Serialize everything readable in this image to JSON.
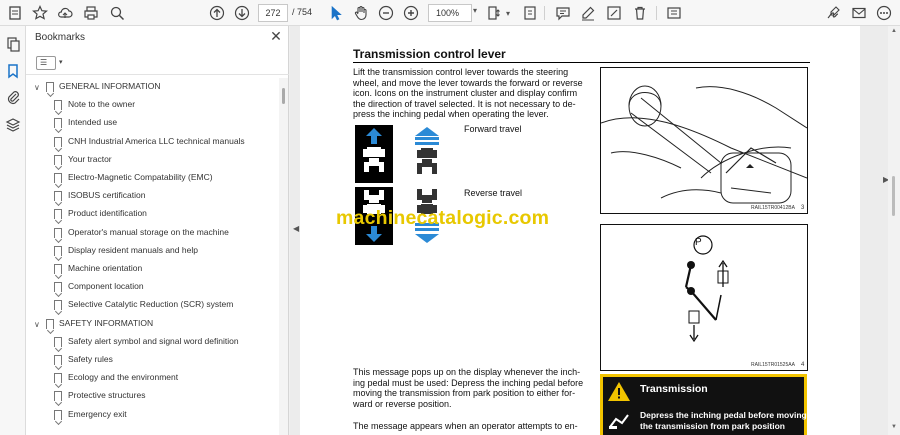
{
  "toolbar": {
    "page_current": "272",
    "page_total": "/ 754",
    "zoom": "100%"
  },
  "bookmarks": {
    "title": "Bookmarks",
    "items": [
      {
        "label": "GENERAL INFORMATION",
        "level": 0,
        "expanded": true
      },
      {
        "label": "Note to the owner",
        "level": 1
      },
      {
        "label": "Intended use",
        "level": 1
      },
      {
        "label": "CNH Industrial America LLC technical manuals",
        "level": 1
      },
      {
        "label": "Your tractor",
        "level": 1
      },
      {
        "label": "Electro-Magnetic Compatability (EMC)",
        "level": 1
      },
      {
        "label": "ISOBUS certification",
        "level": 1
      },
      {
        "label": "Product identification",
        "level": 1
      },
      {
        "label": "Operator's manual storage on the machine",
        "level": 1
      },
      {
        "label": "Display resident manuals and help",
        "level": 1
      },
      {
        "label": "Machine orientation",
        "level": 1
      },
      {
        "label": "Component location",
        "level": 1
      },
      {
        "label": "Selective Catalytic Reduction (SCR) system",
        "level": 1
      },
      {
        "label": "SAFETY INFORMATION",
        "level": 0,
        "expanded": true
      },
      {
        "label": "Safety alert symbol and signal word definition",
        "level": 1
      },
      {
        "label": "Safety rules",
        "level": 1
      },
      {
        "label": "Ecology and the environment",
        "level": 1
      },
      {
        "label": "Protective structures",
        "level": 1
      },
      {
        "label": "Emergency exit",
        "level": 1
      }
    ]
  },
  "document": {
    "heading": "Transmission control lever",
    "paragraph1": [
      "Lift the transmission control lever towards the steering",
      "wheel, and move the lever towards the forward or reverse",
      "icon. Icons on the instrument cluster and display confirm",
      "the direction of travel selected.  It is not necessary to de-",
      "press the inching pedal when operating the lever."
    ],
    "forward_label": "Forward travel",
    "reverse_label": "Reverse travel",
    "fig1_code": "RAIL15TR00412BA",
    "fig1_num": "3",
    "fig2_code": "RAIL15TR01525AA",
    "fig2_num": "4",
    "paragraph2": [
      "This message pops up on the display whenever the inch-",
      "ing pedal must be used: Depress the inching pedal before",
      "moving the transmission from park position to either for-",
      "ward or reverse position."
    ],
    "paragraph3": "The message appears when an operator attempts to en-",
    "warning_title": "Transmission",
    "warning_text": "Depress the inching pedal before moving the transmission from park position",
    "park_symbol": "P",
    "watermark": "machinecatalogic.com"
  },
  "colors": {
    "accent_blue": "#1a73c8",
    "warning_yellow": "#f2c400",
    "watermark_yellow": "#e8c800"
  }
}
